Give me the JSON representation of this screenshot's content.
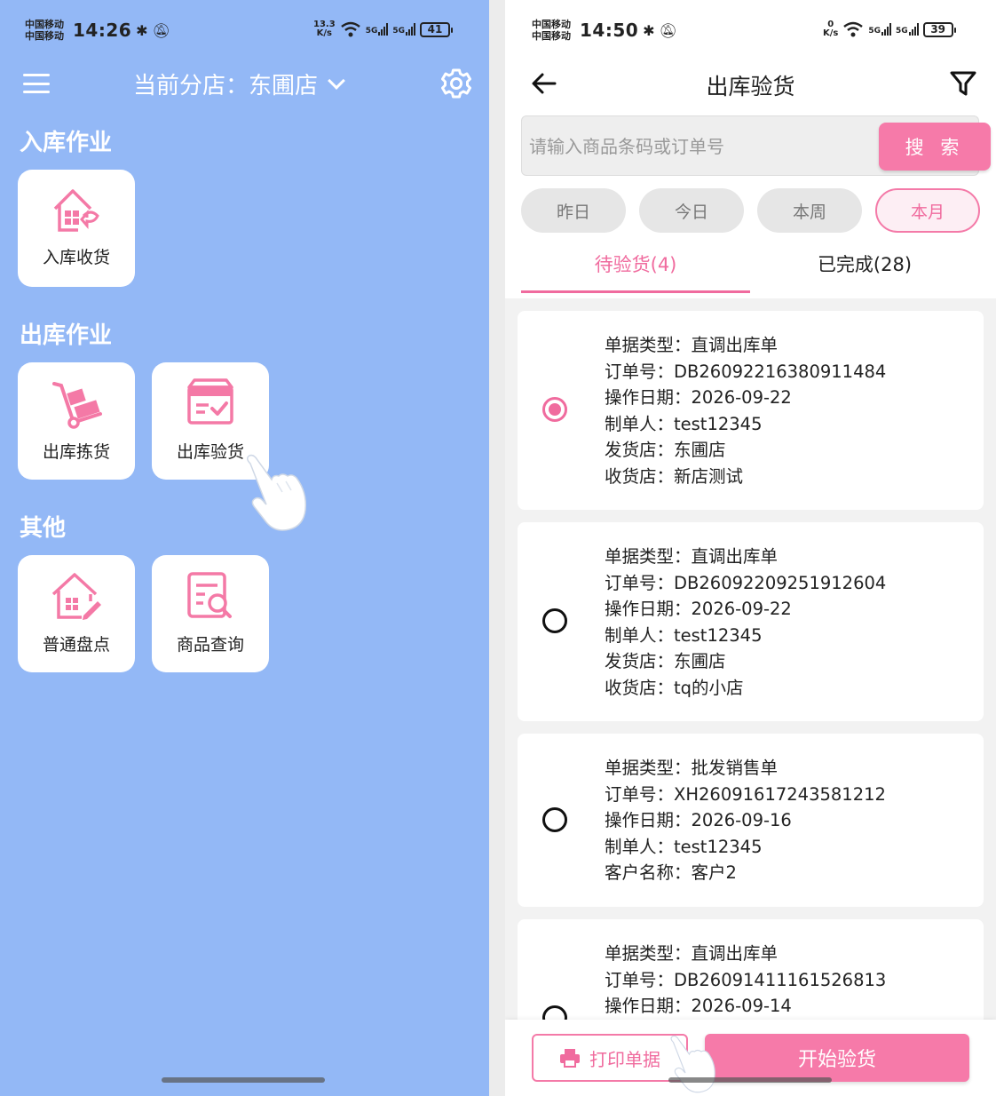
{
  "left": {
    "status": {
      "carrier_line1": "中国移动",
      "carrier_line2": "中国移动",
      "time": "14:26",
      "speed_value": "13.3",
      "speed_unit": "K/s",
      "wifi_label": "7",
      "sim1": "5G",
      "sim2": "5G",
      "battery": "41"
    },
    "header": {
      "store_label": "当前分店：东圃店"
    },
    "sections": {
      "inbound": "入库作业",
      "outbound": "出库作业",
      "other": "其他"
    },
    "tiles": {
      "receive": "入库收货",
      "pick": "出库拣货",
      "check": "出库验货",
      "stocktake": "普通盘点",
      "query": "商品查询"
    }
  },
  "right": {
    "status": {
      "carrier_line1": "中国移动",
      "carrier_line2": "中国移动",
      "time": "14:50",
      "speed_value": "0",
      "speed_unit": "K/s",
      "wifi_label": "7",
      "sim1": "5G",
      "sim2": "5G",
      "battery": "39"
    },
    "header": {
      "title": "出库验货"
    },
    "search": {
      "placeholder": "请输入商品条码或订单号",
      "button": "搜 索"
    },
    "chips": {
      "yesterday": "昨日",
      "today": "今日",
      "week": "本周",
      "month": "本月",
      "selected": "本月"
    },
    "tabs": {
      "pending": "待验货(4)",
      "done": "已完成(28)"
    },
    "orders": [
      {
        "selected": true,
        "lines": [
          "单据类型：直调出库单",
          "订单号：DB26092216380911484",
          "操作日期：2026-09-22",
          "制单人：test12345",
          "发货店：东圃店",
          "收货店：新店测试"
        ]
      },
      {
        "selected": false,
        "lines": [
          "单据类型：直调出库单",
          "订单号：DB26092209251912604",
          "操作日期：2026-09-22",
          "制单人：test12345",
          "发货店：东圃店",
          "收货店：tq的小店"
        ]
      },
      {
        "selected": false,
        "lines": [
          "单据类型：批发销售单",
          "订单号：XH26091617243581212",
          "操作日期：2026-09-16",
          "制单人：test12345",
          "客户名称：客户2"
        ]
      },
      {
        "selected": false,
        "lines": [
          "单据类型：直调出库单",
          "订单号：DB26091411161526813",
          "操作日期：2026-09-14"
        ]
      }
    ],
    "bottom": {
      "print": "打印单据",
      "start": "开始验货"
    }
  },
  "colors": {
    "left_bg": "#93b8f6",
    "accent_pink": "#f67aa9"
  }
}
